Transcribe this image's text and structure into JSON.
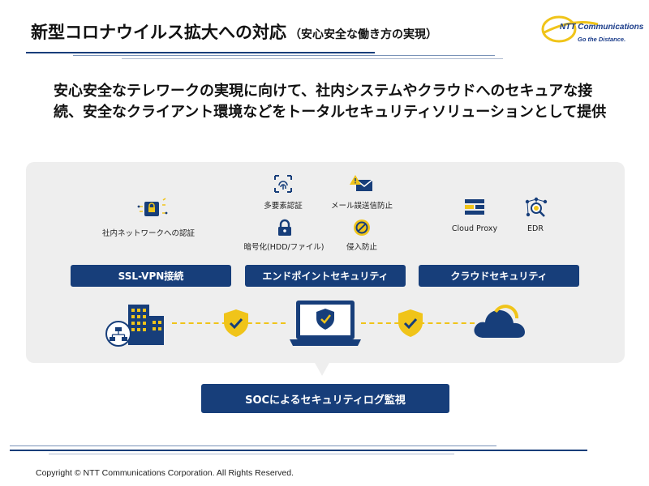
{
  "header": {
    "title": "新型コロナウイルス拡大への対応",
    "subtitle": "（安心安全な働き方の実現）",
    "logo_text": "NTT Communications",
    "logo_tagline": "Go the Distance."
  },
  "lead_text": "安心安全なテレワークの実現に向けて、社内システムやクラウドへのセキュアな接続、安全なクライアント環境などをトータルセキュリティソリューションとして提供",
  "features": {
    "network_auth": "社内ネットワークへの認証",
    "mfa": "多要素認証",
    "mail_misdelivery": "メール誤送信防止",
    "encryption": "暗号化(HDD/ファイル)",
    "intrusion_prevention": "侵入防止",
    "cloud_proxy": "Cloud Proxy",
    "edr": "EDR"
  },
  "categories": {
    "ssl_vpn": "SSL-VPN接続",
    "endpoint": "エンドポイントセキュリティ",
    "cloud": "クラウドセキュリティ"
  },
  "soc": "SOCによるセキュリティログ監視",
  "footer": "Copyright © NTT Communications Corporation. All Rights Reserved.",
  "colors": {
    "navy": "#173e7a",
    "yellow": "#f0c419",
    "panel_bg": "#eeeeee"
  }
}
